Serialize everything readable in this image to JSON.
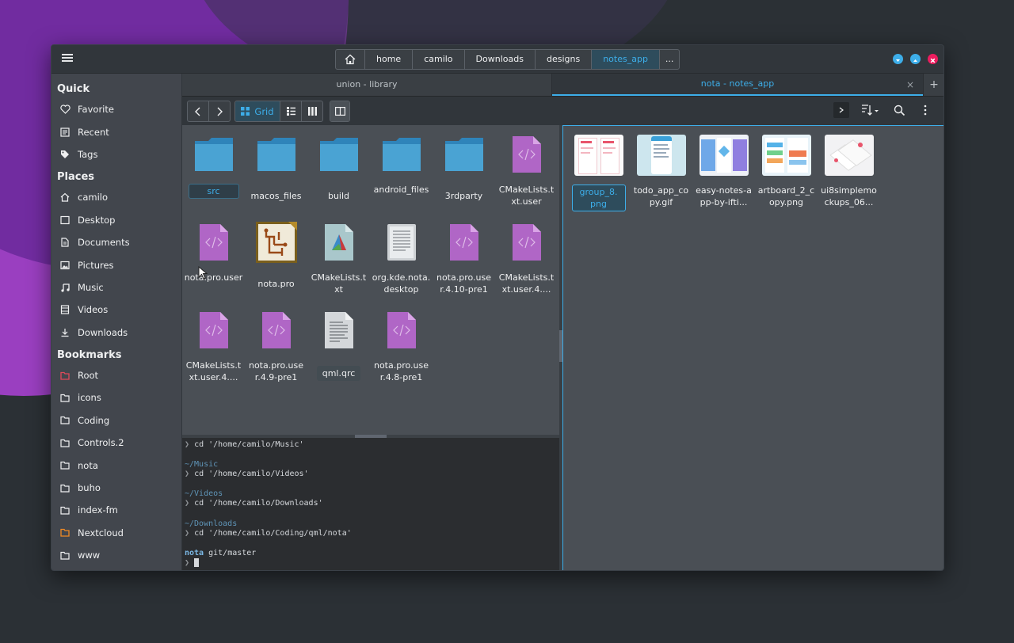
{
  "breadcrumbs": [
    "home",
    "camilo",
    "Downloads",
    "designs",
    "notes_app",
    "..."
  ],
  "sidebar": {
    "quick_title": "Quick",
    "quick": [
      "Favorite",
      "Recent",
      "Tags"
    ],
    "places_title": "Places",
    "places": [
      "camilo",
      "Desktop",
      "Documents",
      "Pictures",
      "Music",
      "Videos",
      "Downloads"
    ],
    "bookmarks_title": "Bookmarks",
    "bookmarks": [
      "Root",
      "icons",
      "Coding",
      "Controls.2",
      "nota",
      "buho",
      "index-fm",
      "Nextcloud",
      "www"
    ]
  },
  "tabs": [
    {
      "label": "union  -  library"
    },
    {
      "label": "nota  -  notes_app"
    }
  ],
  "tab_close": "×",
  "tab_add": "+",
  "toolbar": {
    "grid_label": "Grid"
  },
  "left_files": [
    {
      "name": "src",
      "type": "folder"
    },
    {
      "name": "macos_files",
      "type": "folder"
    },
    {
      "name": "build",
      "type": "folder"
    },
    {
      "name": "android_files",
      "type": "folder"
    },
    {
      "name": "3rdparty",
      "type": "folder"
    },
    {
      "name": "CMakeLists.txt.user",
      "type": "code"
    },
    {
      "name": "nota.pro.user",
      "type": "code"
    },
    {
      "name": "nota.pro",
      "type": "qtcreator"
    },
    {
      "name": "CMakeLists.txt",
      "type": "cmake"
    },
    {
      "name": "org.kde.nota.desktop",
      "type": "desktop"
    },
    {
      "name": "nota.pro.user.4.10-pre1",
      "type": "code"
    },
    {
      "name": "CMakeLists.txt.user.4....",
      "type": "code"
    },
    {
      "name": "CMakeLists.txt.user.4....",
      "type": "code"
    },
    {
      "name": "nota.pro.user.4.9-pre1",
      "type": "code"
    },
    {
      "name": "qml.qrc",
      "type": "text"
    },
    {
      "name": "nota.pro.user.4.8-pre1",
      "type": "code"
    }
  ],
  "right_files": [
    {
      "name": "group_8.png"
    },
    {
      "name": "todo_app_copy.gif"
    },
    {
      "name": "easy-notes-app-by-ifti..."
    },
    {
      "name": "artboard_2_copy.png"
    },
    {
      "name": "ui8simplemockups_06..."
    }
  ],
  "terminal": {
    "prompt": "❯",
    "lines": [
      {
        "kind": "cmd",
        "text": "cd '/home/camilo/Music'"
      },
      {
        "kind": "dir",
        "text": "~/Music"
      },
      {
        "kind": "cmd",
        "text": "cd '/home/camilo/Videos'"
      },
      {
        "kind": "dir",
        "text": "~/Videos"
      },
      {
        "kind": "cmd",
        "text": "cd '/home/camilo/Downloads'"
      },
      {
        "kind": "dir",
        "text": "~/Downloads"
      },
      {
        "kind": "cmd",
        "text": "cd '/home/camilo/Coding/qml/nota'"
      }
    ],
    "cwd": "nota",
    "git": "git/master"
  },
  "colors": {
    "accent": "#3daee9",
    "folder": "#4aa3d3",
    "code_file": "#b066c6",
    "win_min": "#3daee9",
    "win_max": "#3daee9",
    "win_close": "#ed1c5e"
  }
}
